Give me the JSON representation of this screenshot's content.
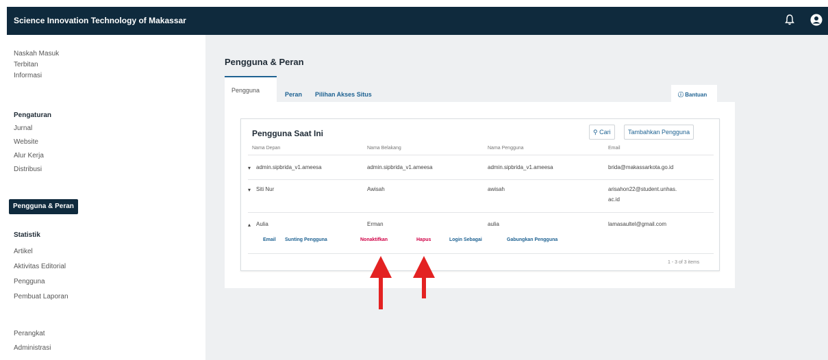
{
  "header": {
    "title": "Science Innovation Technology of Makassar"
  },
  "sidebar": {
    "group1": [
      "Naskah Masuk",
      "Terbitan",
      "Informasi"
    ],
    "settings_heading": "Pengaturan",
    "settings_items": [
      "Jurnal",
      "Website",
      "Alur Kerja",
      "Distribusi"
    ],
    "active_item": "Pengguna & Peran",
    "stats_heading": "Statistik",
    "stats_items": [
      "Artikel",
      "Aktivitas Editorial",
      "Pengguna",
      "Pembuat Laporan"
    ],
    "tools_items": [
      "Perangkat",
      "Administrasi"
    ]
  },
  "page": {
    "title": "Pengguna & Peran",
    "tabs": [
      "Pengguna",
      "Peran",
      "Pilihan Akses Situs"
    ],
    "help_label": "Bantuan"
  },
  "card": {
    "title": "Pengguna Saat Ini",
    "search_label": "Cari",
    "add_label": "Tambahkan Pengguna",
    "columns": [
      "Nama Depan",
      "Nama Belakang",
      "Nama Pengguna",
      "Email"
    ],
    "rows": [
      {
        "first": "admin.sipbrida_v1.ameesa",
        "last": "admin.sipbrida_v1.ameesa",
        "username": "admin.sipbrida_v1.ameesa",
        "email": "brida@makassarkota.go.id"
      },
      {
        "first": "Siti Nur",
        "last": "Awisah",
        "username": "awisah",
        "email_line1": "arisahon22@student.unhas.",
        "email_line2": "ac.id"
      },
      {
        "first": "Aulia",
        "last": "Erman",
        "username": "aulia",
        "email": "lamasaultel@gmail.com"
      }
    ],
    "row_actions": [
      "Email",
      "Sunting Pengguna",
      "Nonaktifkan",
      "Hapus",
      "Login Sebagai",
      "Gabungkan Pengguna"
    ],
    "pagination": "1 - 3 of 3 items"
  },
  "colors": {
    "header_bg": "#0f2a3d",
    "accent": "#1e6292",
    "danger": "#d00046",
    "arrow": "#e32222"
  }
}
